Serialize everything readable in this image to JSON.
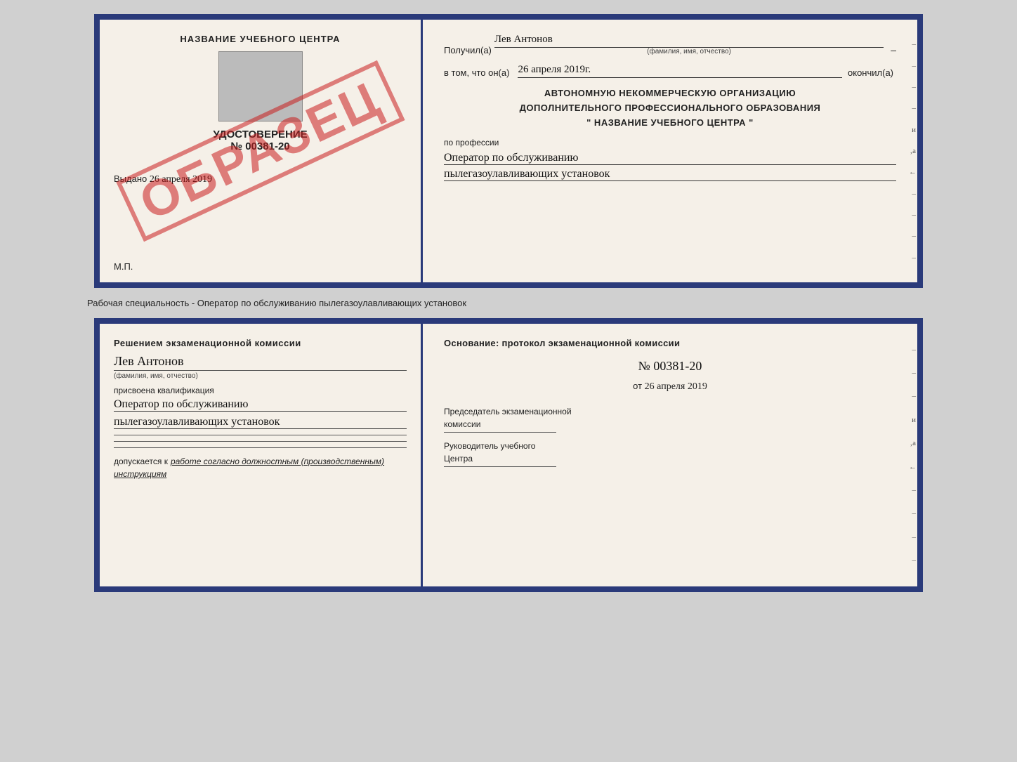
{
  "page": {
    "background": "#d0d0d0"
  },
  "top_left": {
    "center_name": "НАЗВАНИЕ УЧЕБНОГО ЦЕНТРА",
    "cert_title": "УДОСТОВЕРЕНИЕ",
    "cert_number": "№ 00381-20",
    "issued_label": "Выдано",
    "issued_date": "26 апреля 2019",
    "mp_label": "М.П.",
    "stamp_text": "ОБРАЗЕЦ"
  },
  "top_right": {
    "received_label": "Получил(а)",
    "received_name": "Лев Антонов",
    "name_sub": "(фамилия, имя, отчество)",
    "in_that_label": "в том, что он(а)",
    "date_handwritten": "26 апреля 2019г.",
    "finished_label": "окончил(а)",
    "org_line1": "АВТОНОМНУЮ НЕКОММЕРЧЕСКУЮ ОРГАНИЗАЦИЮ",
    "org_line2": "ДОПОЛНИТЕЛЬНОГО ПРОФЕССИОНАЛЬНОГО ОБРАЗОВАНИЯ",
    "org_line3": "\"   НАЗВАНИЕ УЧЕБНОГО ЦЕНТРА   \"",
    "profession_label": "по профессии",
    "profession_line1": "Оператор по обслуживанию",
    "profession_line2": "пылегазоулавливающих установок",
    "margin_items": [
      "–",
      "–",
      "–",
      "–",
      "и",
      "‚а",
      "←",
      "–",
      "–",
      "–",
      "–"
    ]
  },
  "separator": {
    "text": "Рабочая специальность - Оператор по обслуживанию пылегазоулавливающих установок"
  },
  "bottom_left": {
    "title": "Решением экзаменационной комиссии",
    "name_handwritten": "Лев Антонов",
    "name_sub": "(фамилия, имя, отчество)",
    "qualification_label": "присвоена квалификация",
    "qual_line1": "Оператор по обслуживанию",
    "qual_line2": "пылегазоулавливающих установок",
    "underlines": [
      "",
      "",
      ""
    ],
    "допускается_label": "допускается к",
    "допускается_text": "работе согласно должностным (производственным) инструкциям"
  },
  "bottom_right": {
    "osnov_label": "Основание: протокол экзаменационной комиссии",
    "number": "№  00381-20",
    "ot_label": "от",
    "ot_date": "26 апреля 2019",
    "chairman_label1": "Председатель экзаменационной",
    "chairman_label2": "комиссии",
    "rukov_label1": "Руководитель учебного",
    "rukov_label2": "Центра",
    "margin_items": [
      "–",
      "–",
      "–",
      "и",
      "‚а",
      "←",
      "–",
      "–",
      "–",
      "–"
    ]
  }
}
